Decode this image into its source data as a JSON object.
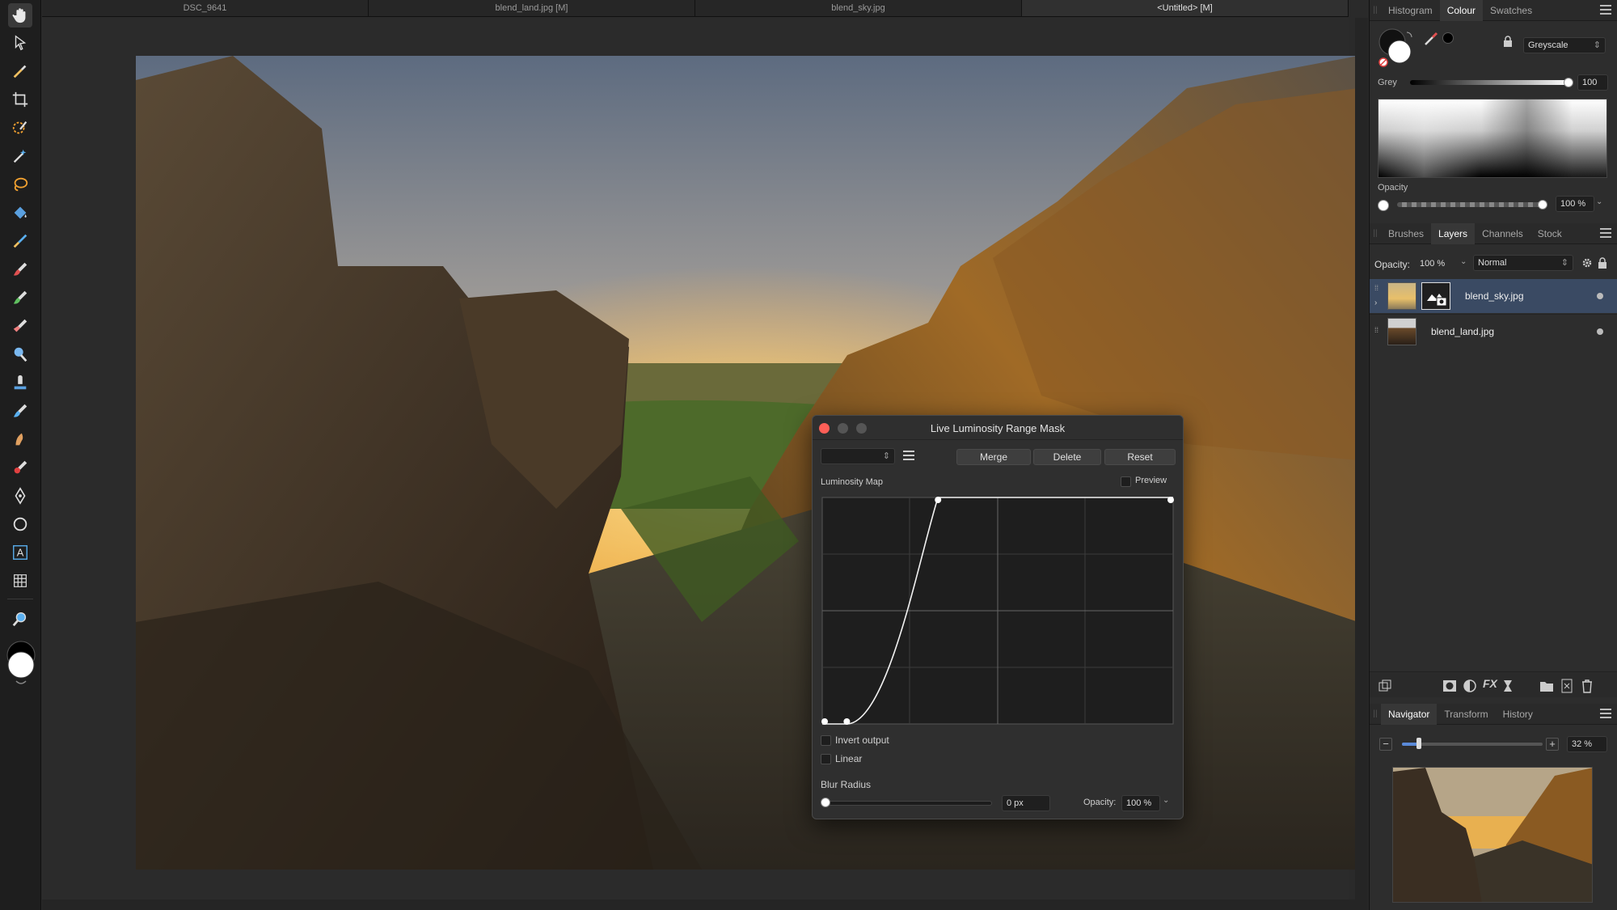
{
  "tabs": [
    "DSC_9641",
    "blend_land.jpg [M]",
    "blend_sky.jpg",
    "<Untitled> [M]"
  ],
  "colour_panel": {
    "tabs": [
      "Histogram",
      "Colour",
      "Swatches"
    ],
    "active_tab": "Colour",
    "mode": "Greyscale",
    "grey_label": "Grey",
    "grey_value": "100",
    "opacity_label": "Opacity",
    "opacity_value": "100 %"
  },
  "layers_panel": {
    "tabs": [
      "Brushes",
      "Layers",
      "Channels",
      "Stock"
    ],
    "active_tab": "Layers",
    "opacity_label": "Opacity:",
    "opacity_value": "100 %",
    "blend_mode": "Normal",
    "layers": [
      {
        "name": "blend_sky.jpg",
        "selected": true
      },
      {
        "name": "blend_land.jpg",
        "selected": false
      }
    ]
  },
  "navigator_panel": {
    "tabs": [
      "Navigator",
      "Transform",
      "History"
    ],
    "active_tab": "Navigator",
    "zoom": "32 %",
    "zoom_fraction": 0.12
  },
  "dialog": {
    "title": "Live Luminosity Range Mask",
    "merge": "Merge",
    "delete": "Delete",
    "reset": "Reset",
    "map_label": "Luminosity Map",
    "preview": "Preview",
    "invert_output": "Invert output",
    "linear": "Linear",
    "blur_label": "Blur Radius",
    "blur_value": "0 px",
    "opacity_label": "Opacity:",
    "opacity_value": "100 %",
    "curve_points": [
      [
        0,
        0
      ],
      [
        0.07,
        0
      ],
      [
        0.33,
        1
      ],
      [
        1,
        1
      ]
    ]
  },
  "colors": {
    "accent_selected": "#3a4a63",
    "close_light": "#ff5f57"
  }
}
